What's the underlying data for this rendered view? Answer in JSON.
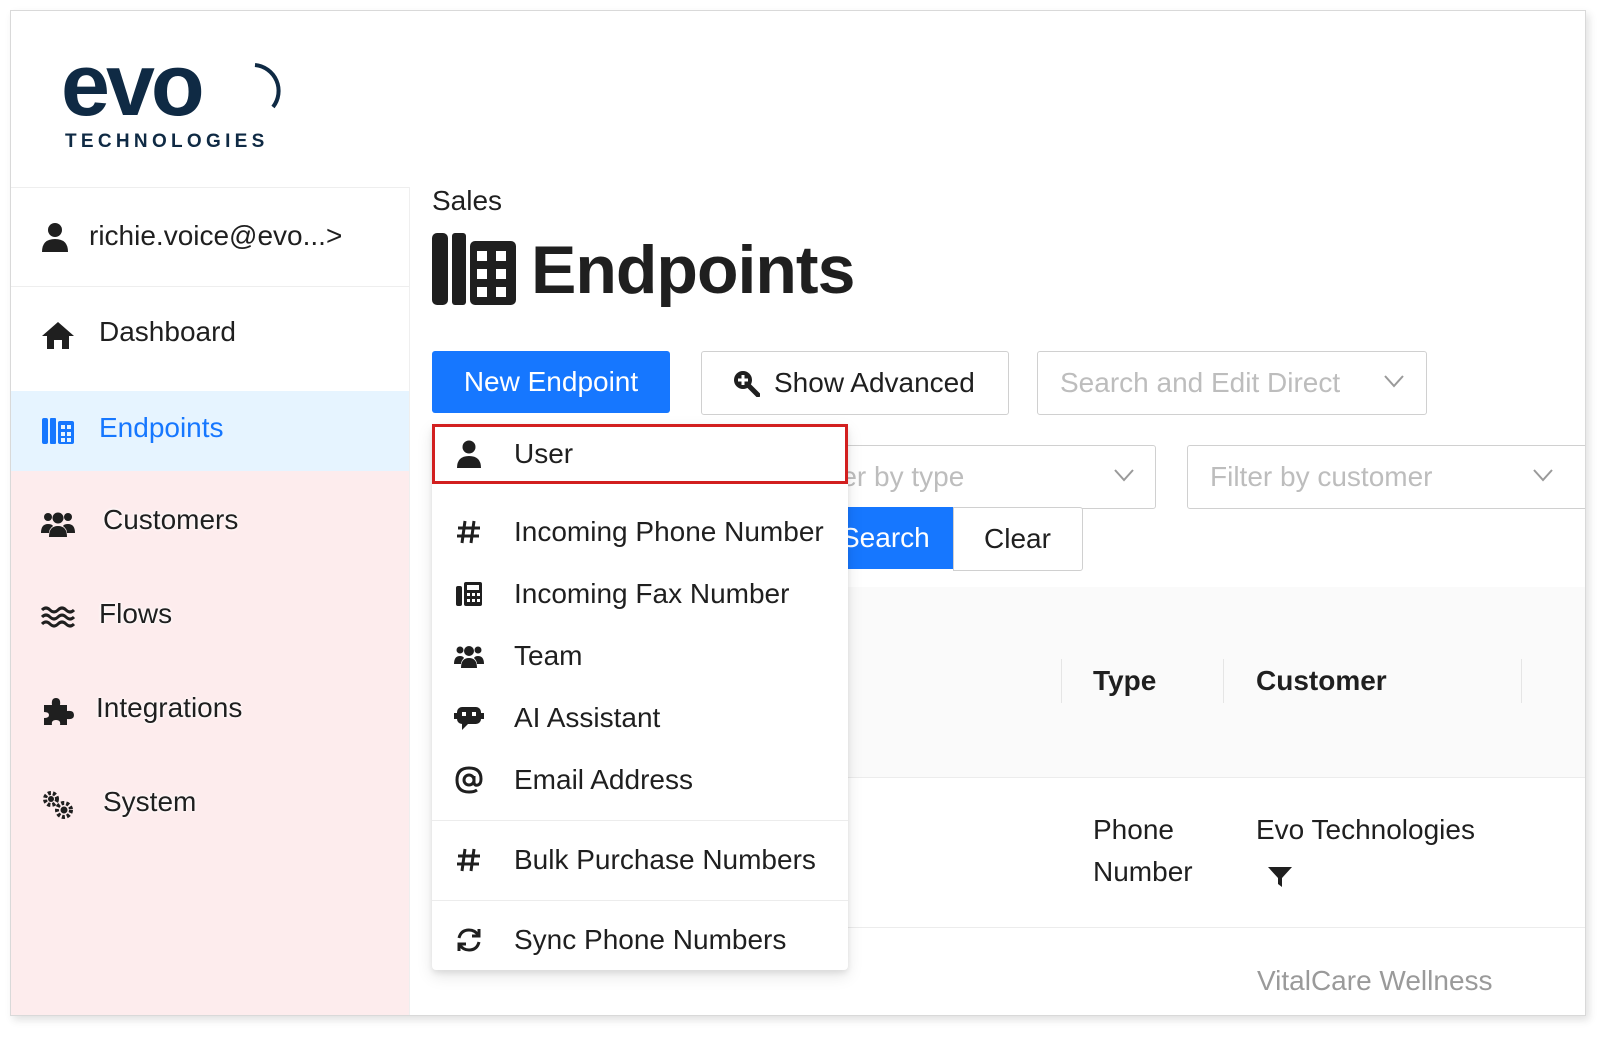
{
  "logo": {
    "wordmark": "evo",
    "tagline": "TECHNOLOGIES"
  },
  "sidebar": {
    "user": {
      "label": "richie.voice@evo...",
      "arrow": ">"
    },
    "items": [
      {
        "label": "Dashboard",
        "icon": "home-icon",
        "active": false
      },
      {
        "label": "Endpoints",
        "icon": "endpoints-icon",
        "active": true
      },
      {
        "label": "Customers",
        "icon": "users-icon",
        "active": false
      },
      {
        "label": "Flows",
        "icon": "flows-icon",
        "active": false
      },
      {
        "label": "Integrations",
        "icon": "puzzle-icon",
        "active": false
      },
      {
        "label": "System",
        "icon": "gears-icon",
        "active": false
      }
    ]
  },
  "header": {
    "breadcrumb": "Sales",
    "title": "Endpoints"
  },
  "toolbar": {
    "new_endpoint": "New Endpoint",
    "show_advanced": "Show Advanced",
    "search_direct_placeholder": "Search and Edit Direct",
    "filter_type_placeholder": "Filter by type",
    "filter_customer_placeholder": "Filter by customer",
    "search": "Search",
    "clear": "Clear"
  },
  "new_endpoint_menu": {
    "items": [
      {
        "label": "User",
        "icon": "user-icon",
        "highlighted": true
      },
      {
        "label": "Incoming Phone Number",
        "icon": "hash-icon"
      },
      {
        "label": "Incoming Fax Number",
        "icon": "fax-icon"
      },
      {
        "label": "Team",
        "icon": "team-icon"
      },
      {
        "label": "AI Assistant",
        "icon": "robot-icon"
      },
      {
        "label": "Email Address",
        "icon": "at-icon"
      },
      {
        "label": "Bulk Purchase Numbers",
        "icon": "hash-icon"
      },
      {
        "label": "Sync Phone Numbers",
        "icon": "sync-icon"
      }
    ]
  },
  "table": {
    "columns": [
      "Type",
      "Customer"
    ],
    "rows": [
      {
        "type": [
          "Phone",
          "Number"
        ],
        "customer": "Evo Technologies"
      },
      {
        "type": [],
        "customer": "VitalCare Wellness"
      }
    ]
  },
  "colors": {
    "primary": "#1677ff",
    "active_bg": "#e6f4ff",
    "highlight_border": "#d21f1f",
    "logo": "#0f2a44"
  }
}
